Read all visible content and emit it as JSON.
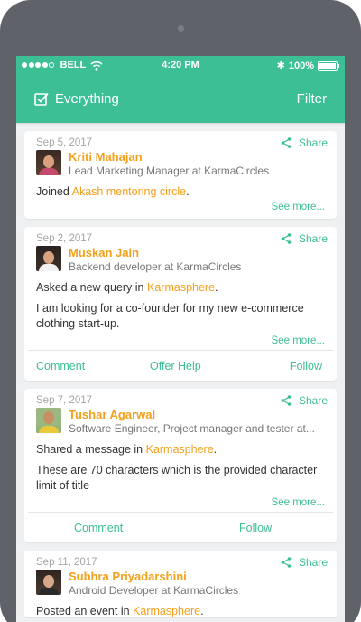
{
  "status_bar": {
    "carrier": "BELL",
    "time": "4:20 PM",
    "battery": "100%",
    "signal_bars": 4,
    "battery_level": 1.0
  },
  "app_bar": {
    "title": "Everything",
    "filter_label": "Filter"
  },
  "colors": {
    "accent": "#3cbf95",
    "highlight": "#f4a01a",
    "background": "#eef0f1"
  },
  "feed": [
    {
      "date": "Sep 5, 2017",
      "share_label": "Share",
      "name": "Kriti Mahajan",
      "role": "Lead Marketing Manager at KarmaCircles",
      "activity_prefix": "Joined ",
      "activity_link": "Akash mentoring circle",
      "activity_suffix": ".",
      "see_more": "See more..."
    },
    {
      "date": "Sep 2, 2017",
      "share_label": "Share",
      "name": "Muskan Jain",
      "role": "Backend developer at KarmaCircles",
      "activity_prefix": "Asked a new query in ",
      "activity_link": "Karmasphere",
      "activity_suffix": ".",
      "message": "I am looking for a co-founder for my new e-commerce clothing start-up.",
      "see_more": "See more...",
      "actions": [
        "Comment",
        "Offer Help",
        "Follow"
      ]
    },
    {
      "date": "Sep 7, 2017",
      "share_label": "Share",
      "name": "Tushar Agarwal",
      "role": "Software Engineer, Project manager and tester at...",
      "activity_prefix": "Shared a message in ",
      "activity_link": "Karmasphere",
      "activity_suffix": ".",
      "message": "These are 70 characters which is the provided character limit of title",
      "see_more": "See more...",
      "actions": [
        "Comment",
        "Follow"
      ]
    },
    {
      "date": "Sep 11, 2017",
      "share_label": "Share",
      "name": "Subhra Priyadarshini",
      "role": "Android Developer at KarmaCircles",
      "activity_prefix": "Posted an event in ",
      "activity_link": "Karmasphere",
      "activity_suffix": "."
    }
  ]
}
